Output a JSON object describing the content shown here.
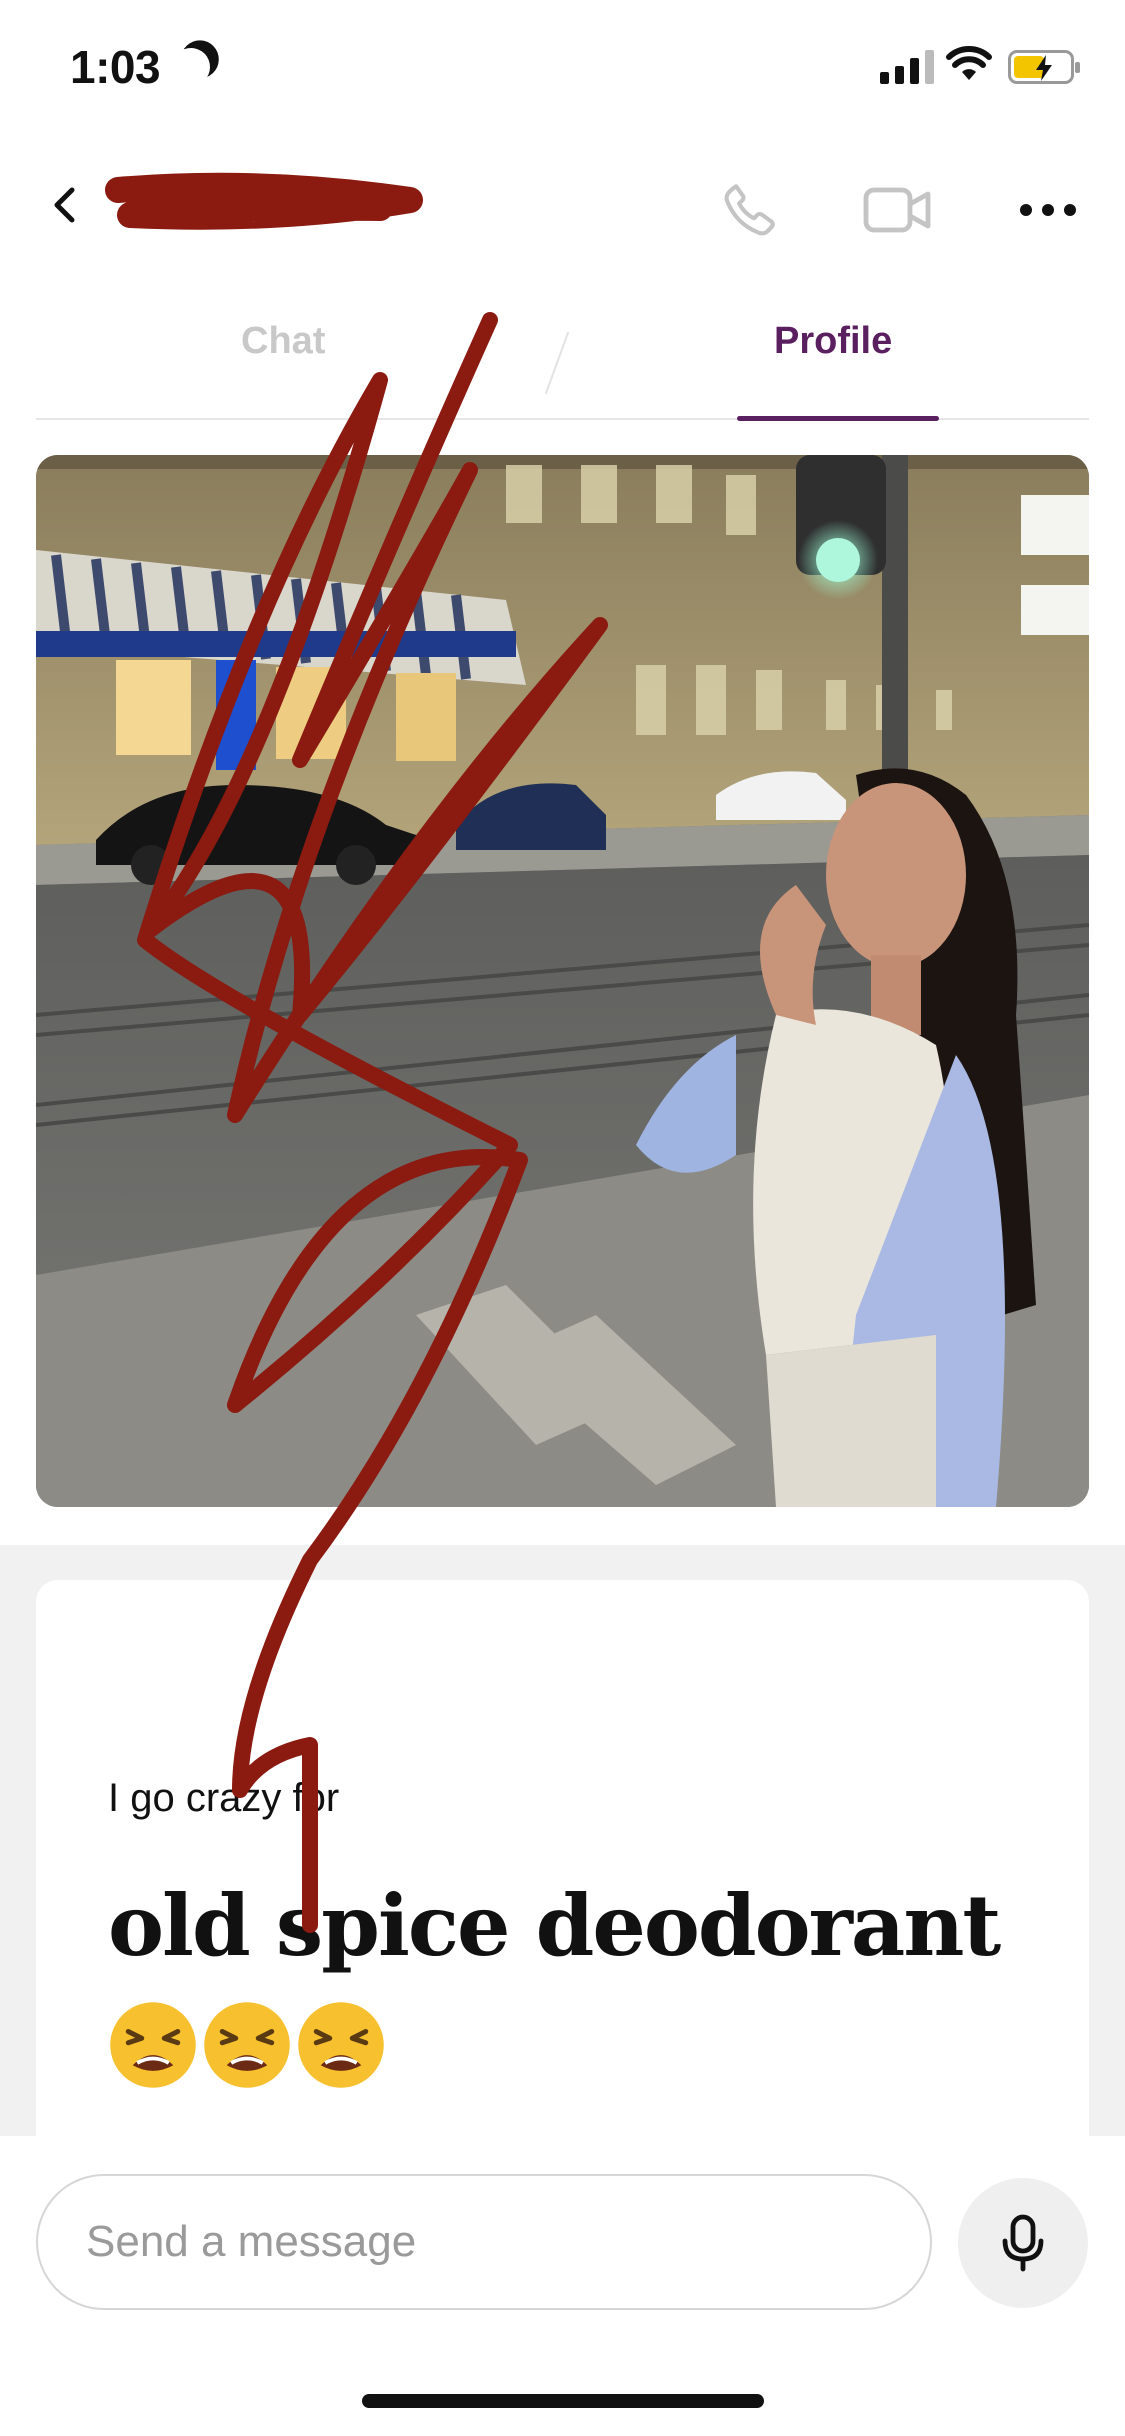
{
  "status_bar": {
    "time": "1:03",
    "icons": [
      "moon-icon",
      "cellular-signal-icon",
      "wifi-icon",
      "battery-charging-icon"
    ]
  },
  "header": {
    "contact_name": "",
    "icons": [
      "back-chevron-icon",
      "phone-icon",
      "video-camera-icon",
      "more-dots-icon"
    ]
  },
  "tabs": [
    {
      "label": "Chat",
      "active": false
    },
    {
      "label": "Profile",
      "active": true
    }
  ],
  "colors": {
    "accent": "#5a1f5f",
    "scribble": "#8b1a10",
    "inactive_tab": "#c8c8c8"
  },
  "prompt_card": {
    "prompt": "I go crazy for",
    "answer": "old spice deodorant",
    "emojis": [
      "tired-face-emoji",
      "tired-face-emoji",
      "tired-face-emoji"
    ]
  },
  "composer": {
    "placeholder": "Send a message",
    "mic_icon": "microphone-icon"
  }
}
